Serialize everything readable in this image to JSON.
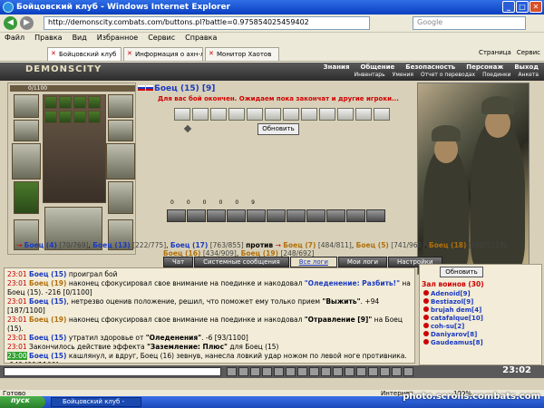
{
  "window": {
    "title": "Бойцовский клуб - Windows Internet Explorer"
  },
  "address": {
    "url": "http://demonscity.combats.com/buttons.pl?battle=0.975854025459402",
    "search_placeholder": "Google"
  },
  "menu": [
    "Файл",
    "Правка",
    "Вид",
    "Избранное",
    "Сервис",
    "Справка"
  ],
  "tabs": [
    {
      "label": "Бойцовский клуб"
    },
    {
      "label": "Информация о ахн-лес"
    },
    {
      "label": "Монитор Хаотов"
    }
  ],
  "ie_tools": {
    "page": "Страница",
    "tools": "Сервис"
  },
  "game": {
    "logo": "DEMONSCITY",
    "nav": [
      "Знания",
      "Общение",
      "Безопасность",
      "Персонаж",
      "Выход"
    ],
    "subnav": [
      "Инвентарь",
      "Умения",
      "Отчет о переводах",
      "Поединки",
      "Анкета"
    ]
  },
  "character": {
    "hp": "0/1100"
  },
  "fight": {
    "opponent": "Боец (15) [9]",
    "wait_message": "Для вас бой окончен. Ожидаем пока закончат и другие игроки...",
    "refresh_button": "Обновить",
    "stats": [
      "0",
      "0",
      "0",
      "0",
      "0",
      "9"
    ]
  },
  "vs": {
    "left": [
      {
        "name": "Боец (4)",
        "hp": "[70/769]"
      },
      {
        "name": "Боец (13)",
        "hp": "[222/775]"
      },
      {
        "name": "Боец (17)",
        "hp": "[763/855]"
      }
    ],
    "against": "против",
    "right": [
      {
        "name": "Боец (7)",
        "hp": "[484/811]"
      },
      {
        "name": "Боец (5)",
        "hp": "[741/969]"
      },
      {
        "name": "Боец (18)",
        "hp": "[580/1218],"
      }
    ],
    "right2": [
      {
        "name": "Боец (16)",
        "hp": "[434/909]"
      },
      {
        "name": "Боец (19)",
        "hp": "[248/692]"
      }
    ]
  },
  "subtabs": [
    "Чат",
    "Системные сообщения",
    "Все логи",
    "Мои логи",
    "Настройки"
  ],
  "log": [
    {
      "time": "23:01",
      "a": "Боец (15)",
      "b": " проиграл бой",
      "c": "",
      "d": ""
    },
    {
      "time": "23:01",
      "a": "Боец (19)",
      "b": " наконец сфокусировал свое внимание на поединке и накодовал ",
      "c": "\"Оледенение: Разбить!\"",
      "d": " на Боец (15). -216 [0/1100]"
    },
    {
      "time": "23:01",
      "a": "Боец (15)",
      "b": ", нетрезво оценив положение, решил, что поможет ему только прием ",
      "c": "\"Выжить\"",
      "d": ". +94 [187/1100]"
    },
    {
      "time": "23:01",
      "a": "Боец (19)",
      "b": " наконец сфокусировал свое внимание на поединке и накодовал ",
      "c": "\"Отравление [9]\"",
      "d": " на Боец (15)."
    },
    {
      "time": "23:01",
      "a": "Боец (15)",
      "b": " утратил здоровье от ",
      "c": "\"Оледенения\"",
      "d": ". -6 [93/1100]"
    },
    {
      "time": "23:01",
      "a": "",
      "b": "Закончилось действие эффекта ",
      "c": "\"Заземление: Плюс\"",
      "d": " для Боец (15)"
    },
    {
      "time": "23:00",
      "a": "Боец (15)",
      "b": " кашлянул, и вдруг, Боец (16) зевнув, нанесла ловкий удар ножом по левой ноге противника. -149 [99/1100]",
      "c": "",
      "d": ""
    }
  ],
  "room": {
    "refresh_button": "Обновить",
    "title": "Зал воинов (30)",
    "players": [
      "Adenoid[9]",
      "Bestiazol[9]",
      "brujah dem[4]",
      "catafalque[10]",
      "coh-su[2]",
      "Daniyarov[8]",
      "Gaudeamus[8]"
    ]
  },
  "clock": "23:02",
  "status": {
    "left": "Готово",
    "zone": "Интернет",
    "zoom": "100%"
  },
  "taskbar": {
    "start": "пуск",
    "task": "Бойцовский клуб -"
  },
  "watermark": "photo.scrolls.combats.com"
}
